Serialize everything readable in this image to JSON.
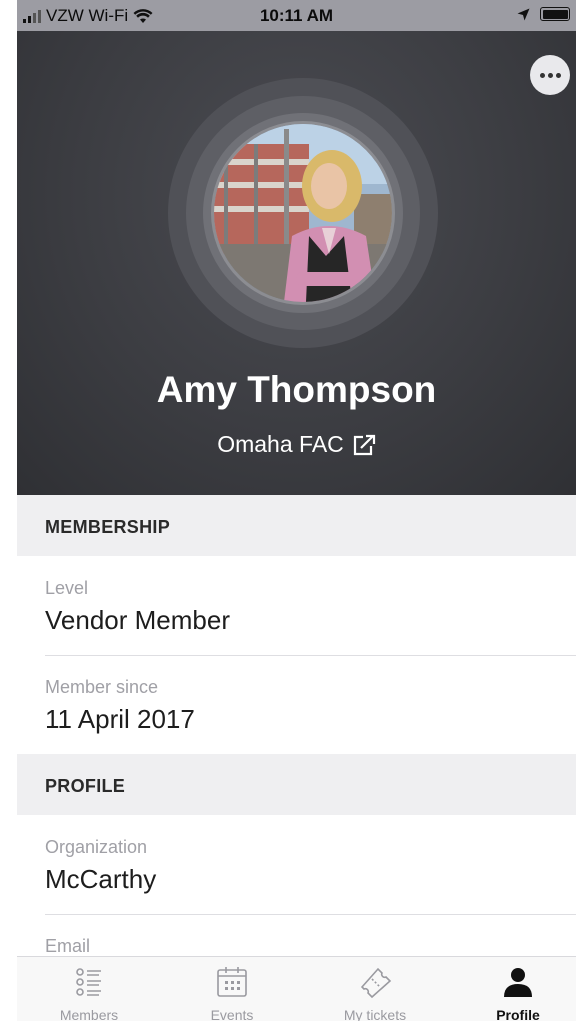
{
  "status_bar": {
    "carrier": "VZW Wi-Fi",
    "time": "10:11 AM"
  },
  "profile": {
    "name": "Amy Thompson",
    "organization_link": "Omaha FAC",
    "avatar_icon": "profile-photo"
  },
  "sections": {
    "membership": {
      "title": "MEMBERSHIP",
      "level_label": "Level",
      "level_value": "Vendor Member",
      "since_label": "Member since",
      "since_value": "11 April 2017"
    },
    "profile": {
      "title": "PROFILE",
      "organization_label": "Organization",
      "organization_value": "McCarthy",
      "email_label": "Email"
    }
  },
  "tabs": [
    {
      "label": "Members",
      "icon": "members-list-icon",
      "active": false
    },
    {
      "label": "Events",
      "icon": "calendar-icon",
      "active": false
    },
    {
      "label": "My tickets",
      "icon": "ticket-icon",
      "active": false
    },
    {
      "label": "Profile",
      "icon": "person-icon",
      "active": true
    }
  ],
  "colors": {
    "hero_background": "#3c3d42",
    "section_background": "#efeff1",
    "inactive_tab": "#9a9aa0",
    "active_tab": "#111111"
  }
}
